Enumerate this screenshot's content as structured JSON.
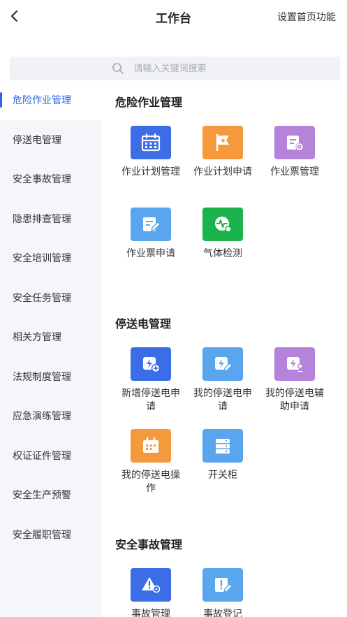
{
  "header": {
    "title": "工作台",
    "settings_label": "设置首页功能"
  },
  "search": {
    "placeholder": "请输入关键词搜索"
  },
  "sidebar": {
    "items": [
      {
        "label": "危险作业管理",
        "active": true
      },
      {
        "label": "停送电管理"
      },
      {
        "label": "安全事故管理"
      },
      {
        "label": "隐患排查管理"
      },
      {
        "label": "安全培训管理"
      },
      {
        "label": "安全任务管理"
      },
      {
        "label": "相关方管理"
      },
      {
        "label": "法规制度管理"
      },
      {
        "label": "应急演练管理"
      },
      {
        "label": "权证证件管理"
      },
      {
        "label": "安全生产预警"
      },
      {
        "label": "安全履职管理"
      }
    ]
  },
  "sections": [
    {
      "title": "危险作业管理",
      "tiles": [
        {
          "label": "作业计划管理",
          "icon": "calendar-icon",
          "color": "#3b6ee6"
        },
        {
          "label": "作业计划申请",
          "icon": "flag-icon",
          "color": "#f59a3c"
        },
        {
          "label": "作业票管理",
          "icon": "ticket-settings-icon",
          "color": "#b583d9"
        },
        {
          "label": "作业票申请",
          "icon": "edit-document-icon",
          "color": "#5aa6ee"
        },
        {
          "label": "气体检测",
          "icon": "gas-detection-icon",
          "color": "#1ab34c"
        }
      ]
    },
    {
      "title": "停送电管理",
      "tiles": [
        {
          "label": "新增停送电申请",
          "icon": "power-add-icon",
          "color": "#3b6ee6"
        },
        {
          "label": "我的停送电申请",
          "icon": "power-edit-icon",
          "color": "#5aa6ee"
        },
        {
          "label": "我的停送电辅助申请",
          "icon": "power-user-icon",
          "color": "#b583d9"
        },
        {
          "label": "我的停送电操作",
          "icon": "power-calendar-icon",
          "color": "#f59a3c"
        },
        {
          "label": "开关柜",
          "icon": "switch-cabinet-icon",
          "color": "#5aa6ee"
        }
      ]
    },
    {
      "title": "安全事故管理",
      "tiles": [
        {
          "label": "事故管理",
          "icon": "warning-settings-icon",
          "color": "#3b6ee6"
        },
        {
          "label": "事故登记",
          "icon": "alert-edit-icon",
          "color": "#5aa6ee"
        }
      ]
    }
  ]
}
